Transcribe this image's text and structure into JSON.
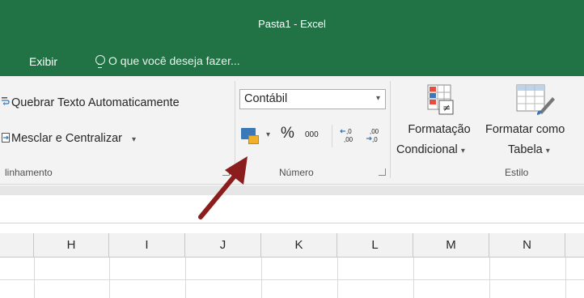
{
  "window": {
    "title": "Pasta1 - Excel"
  },
  "tabs": {
    "exibir": "Exibir",
    "tell_me": "O que você deseja fazer..."
  },
  "ribbon": {
    "alignment": {
      "wrap_text": "Quebrar Texto Automaticamente",
      "merge_center": "Mesclar e Centralizar",
      "merge_caret": "▾",
      "group_label": "linhamento"
    },
    "number": {
      "format_value": "Contábil",
      "format_caret": "▾",
      "accounting_caret": "▾",
      "percent": "%",
      "comma": "000",
      "increase_decimal": "←,0\n,00",
      "decrease_decimal": ",00\n→,0",
      "group_label": "Número"
    },
    "styles": {
      "conditional_line1": "Formatação",
      "conditional_line2": "Condicional",
      "format_table_line1": "Formatar como",
      "format_table_line2": "Tabela",
      "caret": "▾",
      "group_label": "Estilo"
    }
  },
  "grid": {
    "columns": [
      "H",
      "I",
      "J",
      "K",
      "L",
      "M",
      "N"
    ]
  },
  "colors": {
    "excel_green": "#217346",
    "arrow": "#8b1d1d"
  }
}
